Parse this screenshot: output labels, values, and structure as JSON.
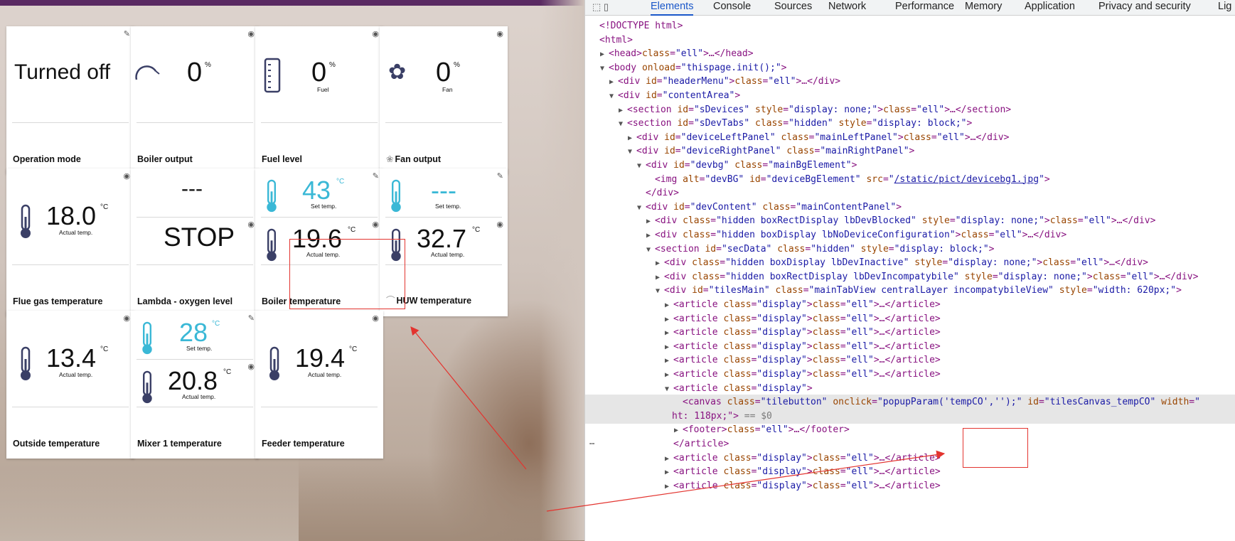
{
  "tiles": [
    {
      "label": "Operation mode",
      "icon": "edit",
      "value": "Turned off"
    },
    {
      "label": "Boiler output",
      "icon": "eye",
      "value": "0",
      "unit": "%"
    },
    {
      "label": "Fuel level",
      "icon": "eye",
      "value": "0",
      "unit": "%",
      "sub": "Fuel"
    },
    {
      "label": "Fan output",
      "icon": "eye",
      "value": "0",
      "unit": "%",
      "sub": "Fan"
    },
    {
      "label": "Flue gas temperature",
      "icon": "eye",
      "value": "18.0",
      "unit": "°C",
      "sub": "Actual temp."
    },
    {
      "label": "Lambda - oxygen level",
      "top_value": "---",
      "value": "STOP",
      "corner_eye": "eye"
    },
    {
      "label": "Boiler temperature",
      "icon": "edit",
      "set_value": "43",
      "set_unit": "°C",
      "set_sub": "Set temp.",
      "value": "19.6",
      "unit": "°C",
      "sub": "Actual temp.",
      "corner_eye": "eye"
    },
    {
      "label": "HUW temperature",
      "icon": "edit",
      "set_value": "---",
      "set_sub": "Set temp.",
      "value": "32.7",
      "unit": "°C",
      "sub": "Actual temp.",
      "corner_eye": "eye"
    },
    {
      "label": "Outside temperature",
      "icon": "eye",
      "value": "13.4",
      "unit": "°C",
      "sub": "Actual temp."
    },
    {
      "label": "Mixer 1 temperature",
      "icon": "edit",
      "set_value": "28",
      "set_unit": "°C",
      "set_sub": "Set temp.",
      "value": "20.8",
      "unit": "°C",
      "sub": "Actual temp.",
      "corner_eye": "eye"
    },
    {
      "label": "Feeder temperature",
      "icon": "eye",
      "value": "19.4",
      "unit": "°C",
      "sub": "Actual temp."
    }
  ],
  "devtools": {
    "tabs": [
      "Elements",
      "Console",
      "Sources",
      "Network",
      "Performance",
      "Memory",
      "Application",
      "Privacy and security",
      "Lig"
    ],
    "active_tab": "Elements",
    "lines": [
      {
        "t": "<!DOCTYPE html>"
      },
      {
        "t": "<html>"
      },
      {
        "t": "<head>…</head>"
      },
      {
        "t": "<body onload=\"thispage.init();\">"
      },
      {
        "t": "<div id=\"headerMenu\">…</div>"
      },
      {
        "t": "<div id=\"contentArea\">"
      },
      {
        "t": "<section id=\"sDevices\" style=\"display: none;\">…</section>"
      },
      {
        "t": "<section id=\"sDevTabs\" class=\"hidden\" style=\"display: block;\">"
      },
      {
        "t": "<div id=\"deviceLeftPanel\" class=\"mainLeftPanel\">…</div>"
      },
      {
        "t": "<div id=\"deviceRightPanel\" class=\"mainRightPanel\">"
      },
      {
        "t": "<div id=\"devbg\" class=\"mainBgElement\">"
      },
      {
        "t": "<img alt=\"devBG\" id=\"deviceBgElement\" src=\"/static/pict/devicebg1.jpg\">"
      },
      {
        "t": "</div>"
      },
      {
        "t": "<div id=\"devContent\" class=\"mainContentPanel\">"
      },
      {
        "t": "<div class=\"hidden boxRectDisplay lbDevBlocked\" style=\"display: none;\">…</div>"
      },
      {
        "t": "<div class=\"hidden boxDisplay lbNoDeviceConfiguration\">…</div>"
      },
      {
        "t": "<section id=\"secData\" class=\"hidden\" style=\"display: block;\">"
      },
      {
        "t": "<div class=\"hidden boxDisplay lbDevInactive\" style=\"display: none;\">…</div>"
      },
      {
        "t": "<div class=\"hidden boxRectDisplay lbDevIncompatybile\" style=\"display: none;\">…</div>"
      },
      {
        "t": "<div id=\"tilesMain\" class=\"mainTabView centralLayer incompatybileView\" style=\"width: 620px;\">"
      },
      {
        "t": "<article class=\"display\">…</article>"
      },
      {
        "t": "<article class=\"display\">…</article>"
      },
      {
        "t": "<article class=\"display\">…</article>"
      },
      {
        "t": "<article class=\"display\">…</article>"
      },
      {
        "t": "<article class=\"display\">…</article>"
      },
      {
        "t": "<article class=\"display\">…</article>"
      },
      {
        "t": "<article class=\"display\">"
      },
      {
        "t": "<canvas class=\"tilebutton\" onclick=\"popupParam('tempCO','');\" id=\"tilesCanvas_tempCO\" width=\""
      },
      {
        "t": "ht: 118px;\"> == $0"
      },
      {
        "t": "<footer>…</footer>"
      },
      {
        "t": "</article>"
      },
      {
        "t": "<article class=\"display\">…</article>"
      },
      {
        "t": "<article class=\"display\">…</article>"
      },
      {
        "t": "<article class=\"display\">…</article>"
      }
    ],
    "gutter_dots": "…"
  },
  "colors": {
    "accent_cyan": "#3ab8d6",
    "header_purple": "#5a2a62",
    "annotation_red": "#e3342f",
    "tab_active": "#1a57c9"
  }
}
